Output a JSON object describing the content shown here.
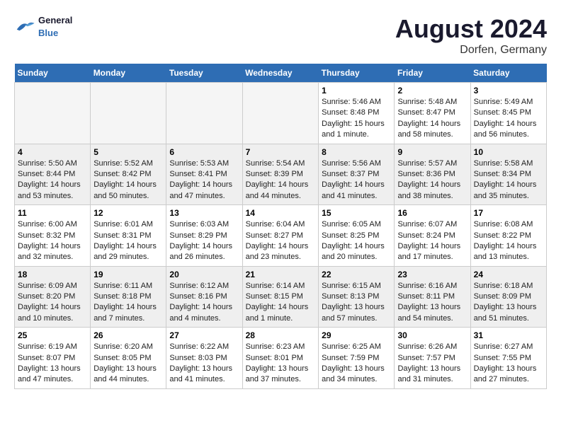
{
  "header": {
    "logo_general": "General",
    "logo_blue": "Blue",
    "month_year": "August 2024",
    "location": "Dorfen, Germany"
  },
  "weekdays": [
    "Sunday",
    "Monday",
    "Tuesday",
    "Wednesday",
    "Thursday",
    "Friday",
    "Saturday"
  ],
  "weeks": [
    {
      "row_class": "row-odd",
      "days": [
        {
          "num": "",
          "info": "",
          "empty": true
        },
        {
          "num": "",
          "info": "",
          "empty": true
        },
        {
          "num": "",
          "info": "",
          "empty": true
        },
        {
          "num": "",
          "info": "",
          "empty": true
        },
        {
          "num": "1",
          "info": "Sunrise: 5:46 AM\nSunset: 8:48 PM\nDaylight: 15 hours\nand 1 minute.",
          "empty": false
        },
        {
          "num": "2",
          "info": "Sunrise: 5:48 AM\nSunset: 8:47 PM\nDaylight: 14 hours\nand 58 minutes.",
          "empty": false
        },
        {
          "num": "3",
          "info": "Sunrise: 5:49 AM\nSunset: 8:45 PM\nDaylight: 14 hours\nand 56 minutes.",
          "empty": false
        }
      ]
    },
    {
      "row_class": "row-even",
      "days": [
        {
          "num": "4",
          "info": "Sunrise: 5:50 AM\nSunset: 8:44 PM\nDaylight: 14 hours\nand 53 minutes.",
          "empty": false
        },
        {
          "num": "5",
          "info": "Sunrise: 5:52 AM\nSunset: 8:42 PM\nDaylight: 14 hours\nand 50 minutes.",
          "empty": false
        },
        {
          "num": "6",
          "info": "Sunrise: 5:53 AM\nSunset: 8:41 PM\nDaylight: 14 hours\nand 47 minutes.",
          "empty": false
        },
        {
          "num": "7",
          "info": "Sunrise: 5:54 AM\nSunset: 8:39 PM\nDaylight: 14 hours\nand 44 minutes.",
          "empty": false
        },
        {
          "num": "8",
          "info": "Sunrise: 5:56 AM\nSunset: 8:37 PM\nDaylight: 14 hours\nand 41 minutes.",
          "empty": false
        },
        {
          "num": "9",
          "info": "Sunrise: 5:57 AM\nSunset: 8:36 PM\nDaylight: 14 hours\nand 38 minutes.",
          "empty": false
        },
        {
          "num": "10",
          "info": "Sunrise: 5:58 AM\nSunset: 8:34 PM\nDaylight: 14 hours\nand 35 minutes.",
          "empty": false
        }
      ]
    },
    {
      "row_class": "row-odd",
      "days": [
        {
          "num": "11",
          "info": "Sunrise: 6:00 AM\nSunset: 8:32 PM\nDaylight: 14 hours\nand 32 minutes.",
          "empty": false
        },
        {
          "num": "12",
          "info": "Sunrise: 6:01 AM\nSunset: 8:31 PM\nDaylight: 14 hours\nand 29 minutes.",
          "empty": false
        },
        {
          "num": "13",
          "info": "Sunrise: 6:03 AM\nSunset: 8:29 PM\nDaylight: 14 hours\nand 26 minutes.",
          "empty": false
        },
        {
          "num": "14",
          "info": "Sunrise: 6:04 AM\nSunset: 8:27 PM\nDaylight: 14 hours\nand 23 minutes.",
          "empty": false
        },
        {
          "num": "15",
          "info": "Sunrise: 6:05 AM\nSunset: 8:25 PM\nDaylight: 14 hours\nand 20 minutes.",
          "empty": false
        },
        {
          "num": "16",
          "info": "Sunrise: 6:07 AM\nSunset: 8:24 PM\nDaylight: 14 hours\nand 17 minutes.",
          "empty": false
        },
        {
          "num": "17",
          "info": "Sunrise: 6:08 AM\nSunset: 8:22 PM\nDaylight: 14 hours\nand 13 minutes.",
          "empty": false
        }
      ]
    },
    {
      "row_class": "row-even",
      "days": [
        {
          "num": "18",
          "info": "Sunrise: 6:09 AM\nSunset: 8:20 PM\nDaylight: 14 hours\nand 10 minutes.",
          "empty": false
        },
        {
          "num": "19",
          "info": "Sunrise: 6:11 AM\nSunset: 8:18 PM\nDaylight: 14 hours\nand 7 minutes.",
          "empty": false
        },
        {
          "num": "20",
          "info": "Sunrise: 6:12 AM\nSunset: 8:16 PM\nDaylight: 14 hours\nand 4 minutes.",
          "empty": false
        },
        {
          "num": "21",
          "info": "Sunrise: 6:14 AM\nSunset: 8:15 PM\nDaylight: 14 hours\nand 1 minute.",
          "empty": false
        },
        {
          "num": "22",
          "info": "Sunrise: 6:15 AM\nSunset: 8:13 PM\nDaylight: 13 hours\nand 57 minutes.",
          "empty": false
        },
        {
          "num": "23",
          "info": "Sunrise: 6:16 AM\nSunset: 8:11 PM\nDaylight: 13 hours\nand 54 minutes.",
          "empty": false
        },
        {
          "num": "24",
          "info": "Sunrise: 6:18 AM\nSunset: 8:09 PM\nDaylight: 13 hours\nand 51 minutes.",
          "empty": false
        }
      ]
    },
    {
      "row_class": "row-odd",
      "days": [
        {
          "num": "25",
          "info": "Sunrise: 6:19 AM\nSunset: 8:07 PM\nDaylight: 13 hours\nand 47 minutes.",
          "empty": false
        },
        {
          "num": "26",
          "info": "Sunrise: 6:20 AM\nSunset: 8:05 PM\nDaylight: 13 hours\nand 44 minutes.",
          "empty": false
        },
        {
          "num": "27",
          "info": "Sunrise: 6:22 AM\nSunset: 8:03 PM\nDaylight: 13 hours\nand 41 minutes.",
          "empty": false
        },
        {
          "num": "28",
          "info": "Sunrise: 6:23 AM\nSunset: 8:01 PM\nDaylight: 13 hours\nand 37 minutes.",
          "empty": false
        },
        {
          "num": "29",
          "info": "Sunrise: 6:25 AM\nSunset: 7:59 PM\nDaylight: 13 hours\nand 34 minutes.",
          "empty": false
        },
        {
          "num": "30",
          "info": "Sunrise: 6:26 AM\nSunset: 7:57 PM\nDaylight: 13 hours\nand 31 minutes.",
          "empty": false
        },
        {
          "num": "31",
          "info": "Sunrise: 6:27 AM\nSunset: 7:55 PM\nDaylight: 13 hours\nand 27 minutes.",
          "empty": false
        }
      ]
    }
  ]
}
